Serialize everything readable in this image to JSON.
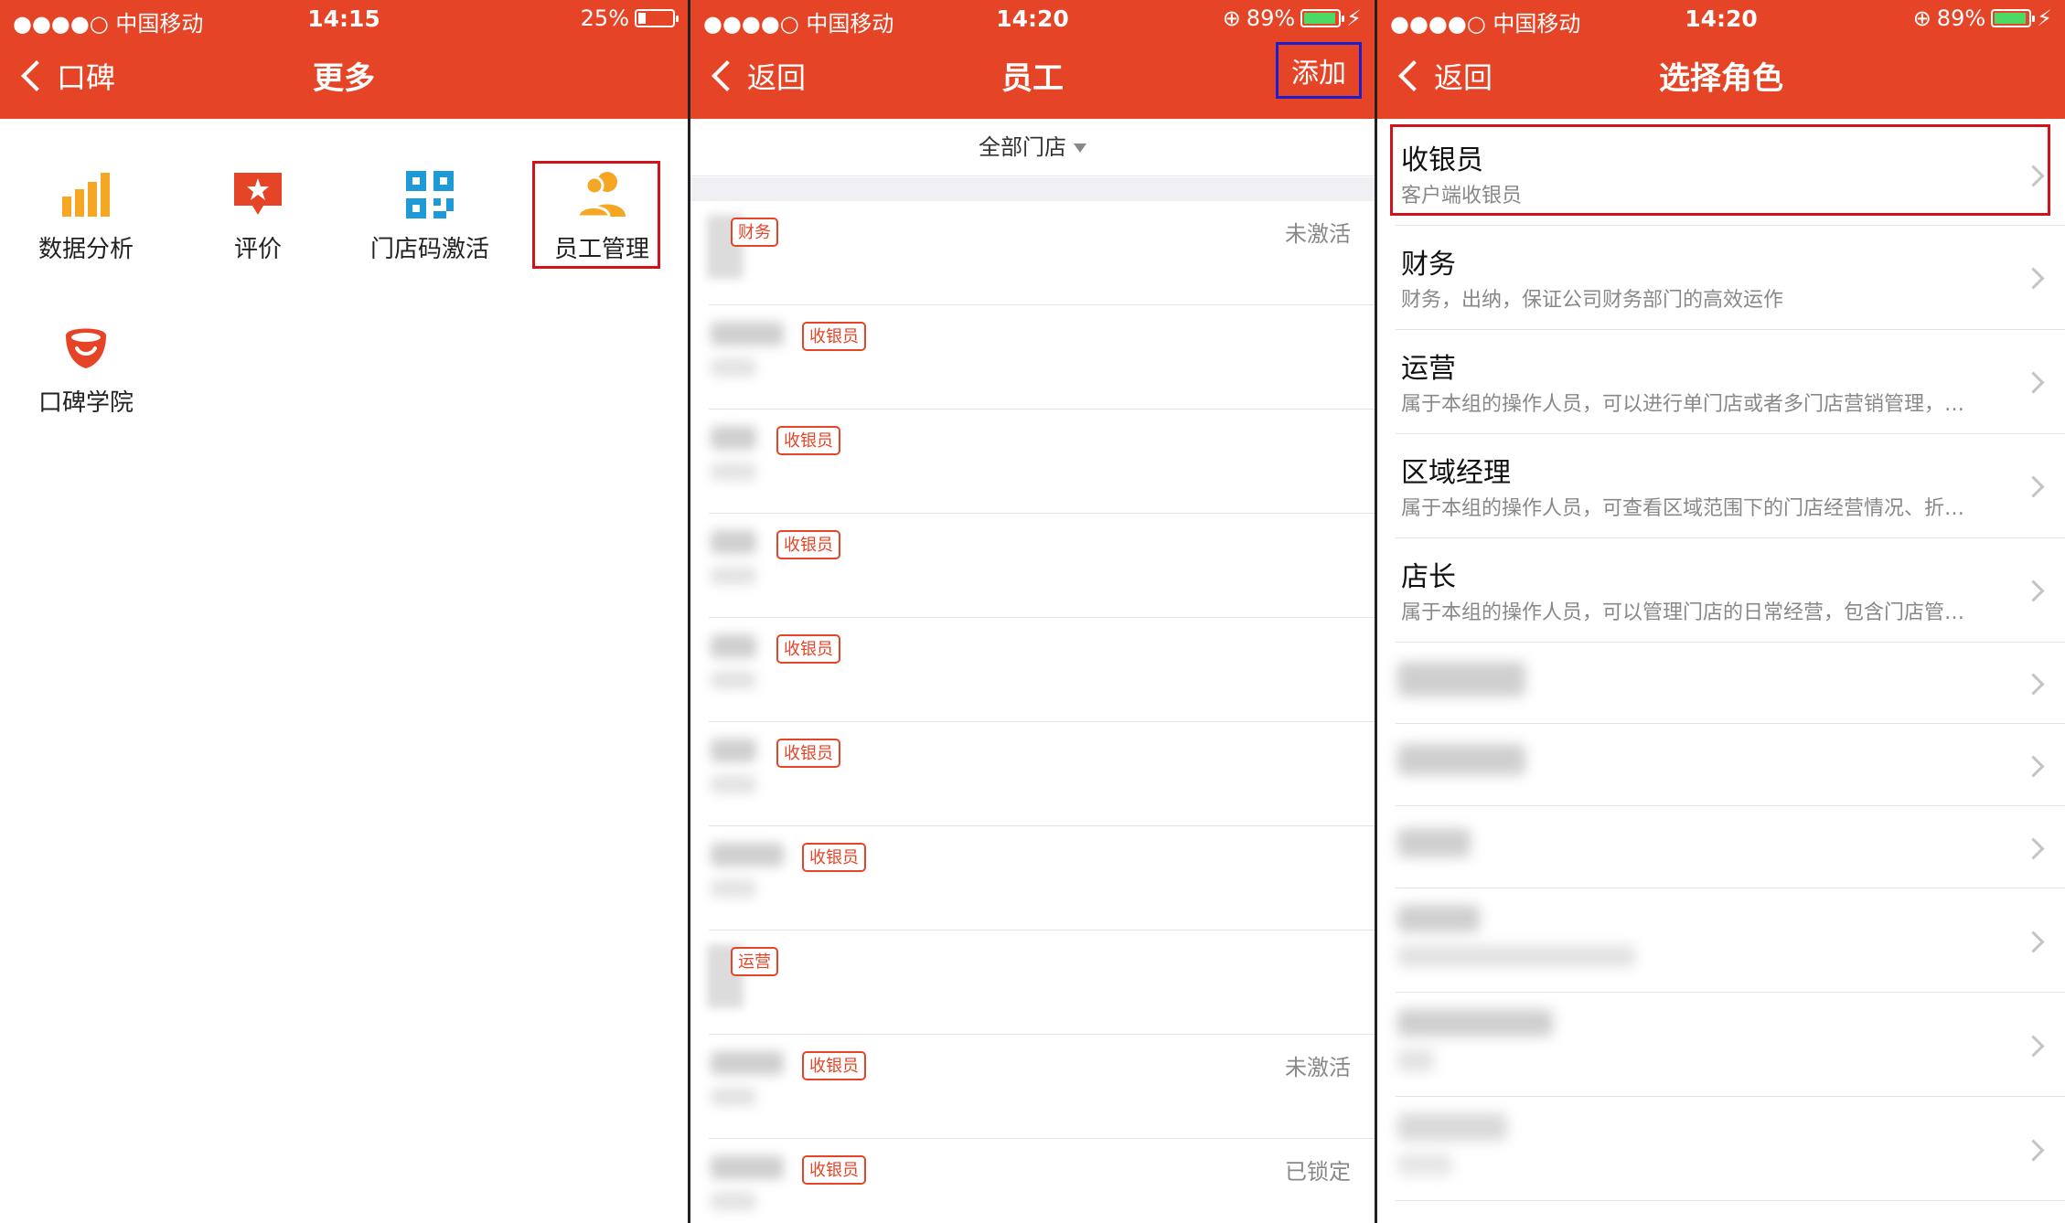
{
  "panel1": {
    "status": {
      "carrier": "●●●●○ 中国移动",
      "time": "14:15",
      "battery": "25%"
    },
    "nav": {
      "back_label": "口碑",
      "title": "更多"
    },
    "items": [
      {
        "label": "数据分析",
        "icon": "bar-chart-icon"
      },
      {
        "label": "评价",
        "icon": "star-comment-icon"
      },
      {
        "label": "门店码激活",
        "icon": "qr-code-icon"
      },
      {
        "label": "员工管理",
        "icon": "people-icon"
      },
      {
        "label": "口碑学院",
        "icon": "koubei-school-icon"
      }
    ]
  },
  "panel2": {
    "status": {
      "carrier": "●●●●○ 中国移动",
      "time": "14:20",
      "battery": "89%"
    },
    "nav": {
      "back_label": "返回",
      "title": "员工",
      "action_label": "添加"
    },
    "filter_label": "全部门店",
    "employees": [
      {
        "role": "财务",
        "status": ""
      },
      {
        "role": "收银员",
        "status": ""
      },
      {
        "role": "收银员",
        "status": ""
      },
      {
        "role": "收银员",
        "status": ""
      },
      {
        "role": "收银员",
        "status": ""
      },
      {
        "role": "收银员",
        "status": ""
      },
      {
        "role": "收银员",
        "status": ""
      },
      {
        "role": "运营",
        "status": ""
      },
      {
        "role": "收银员",
        "status": "未激活"
      },
      {
        "role": "收银员",
        "status": "已锁定"
      }
    ],
    "first_status": "未激活"
  },
  "panel3": {
    "status": {
      "carrier": "●●●●○ 中国移动",
      "time": "14:20",
      "battery": "89%"
    },
    "nav": {
      "back_label": "返回",
      "title": "选择角色"
    },
    "roles": [
      {
        "title": "收银员",
        "desc": "客户端收银员"
      },
      {
        "title": "财务",
        "desc": "财务，出纳，保证公司财务部门的高效运作"
      },
      {
        "title": "运营",
        "desc": "属于本组的操作人员，可以进行单门店或者多门店营销管理，…"
      },
      {
        "title": "区域经理",
        "desc": "属于本组的操作人员，可查看区域范围下的门店经营情况、折…"
      },
      {
        "title": "店长",
        "desc": "属于本组的操作人员，可以管理门店的日常经营，包含门店管…"
      }
    ]
  },
  "colors": {
    "brand_red": "#e64426",
    "highlight_red": "#d0121b",
    "highlight_blue": "#1d1dd0"
  }
}
